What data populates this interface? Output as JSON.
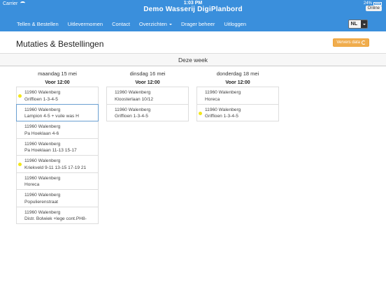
{
  "status": {
    "carrier": "Carrier",
    "time": "1:03 PM",
    "battery": "24%"
  },
  "app": {
    "title": "Demo Wasserij DigiPlanbord",
    "online": "Online"
  },
  "nav": {
    "items": [
      "Tellen & Bestellen",
      "Uitlevermomen",
      "Contact",
      "Overzichten",
      "Drager beheer",
      "Uitloggen"
    ],
    "language": "NL"
  },
  "page": {
    "title": "Mutaties & Bestellingen",
    "refresh_label": "Ververs data"
  },
  "week": {
    "label": "Deze week"
  },
  "days": [
    {
      "label": "maandag 15 mei",
      "time": "Voor 12:00",
      "cards": [
        {
          "line1": "11960 Walenberg",
          "line2": "Griffioen 1-3-4-5",
          "dot": true,
          "selected": false
        },
        {
          "line1": "11960 Walenberg",
          "line2": "Lampion 4-5 + vuile was H",
          "dot": false,
          "selected": true
        },
        {
          "line1": "11960 Walenberg",
          "line2": "Pa Hoeklaan 4-6",
          "dot": false,
          "selected": false
        },
        {
          "line1": "11960 Walenberg",
          "line2": "Pa Hoeklaan 11-13 15-17",
          "dot": false,
          "selected": false
        },
        {
          "line1": "11960 Walenberg",
          "line2": "Kriekveld 9-11 13-15 17-19 21",
          "dot": true,
          "selected": false
        },
        {
          "line1": "11960 Walenberg",
          "line2": "Horeca",
          "dot": false,
          "selected": false
        },
        {
          "line1": "11960 Walenberg",
          "line2": "Populierenstraat",
          "dot": false,
          "selected": false
        },
        {
          "line1": "11960 Walenberg",
          "line2": "Distr. Bolwiek +lege cont.PH8-",
          "dot": false,
          "selected": false
        }
      ]
    },
    {
      "label": "dinsdag 16 mei",
      "time": "Voor 12:00",
      "cards": [
        {
          "line1": "11960 Walenberg",
          "line2": "Kloosterlaan 10/12",
          "dot": false,
          "selected": false
        },
        {
          "line1": "11960 Walenberg",
          "line2": "Griffioen 1-3-4-5",
          "dot": false,
          "selected": false
        }
      ]
    },
    {
      "label": "donderdag 18 mei",
      "time": "Voor 12:00",
      "cards": [
        {
          "line1": "11960 Walenberg",
          "line2": "Horeca",
          "dot": false,
          "selected": false
        },
        {
          "line1": "11960 Walenberg",
          "line2": "Griffioen 1-3-4-5",
          "dot": true,
          "selected": false
        }
      ]
    }
  ],
  "colors": {
    "nav_blue": "#3a8fdc",
    "refresh_orange": "#f0ad4e",
    "dot_yellow": "#f2e61b",
    "selected_border": "#6a9fd1"
  }
}
